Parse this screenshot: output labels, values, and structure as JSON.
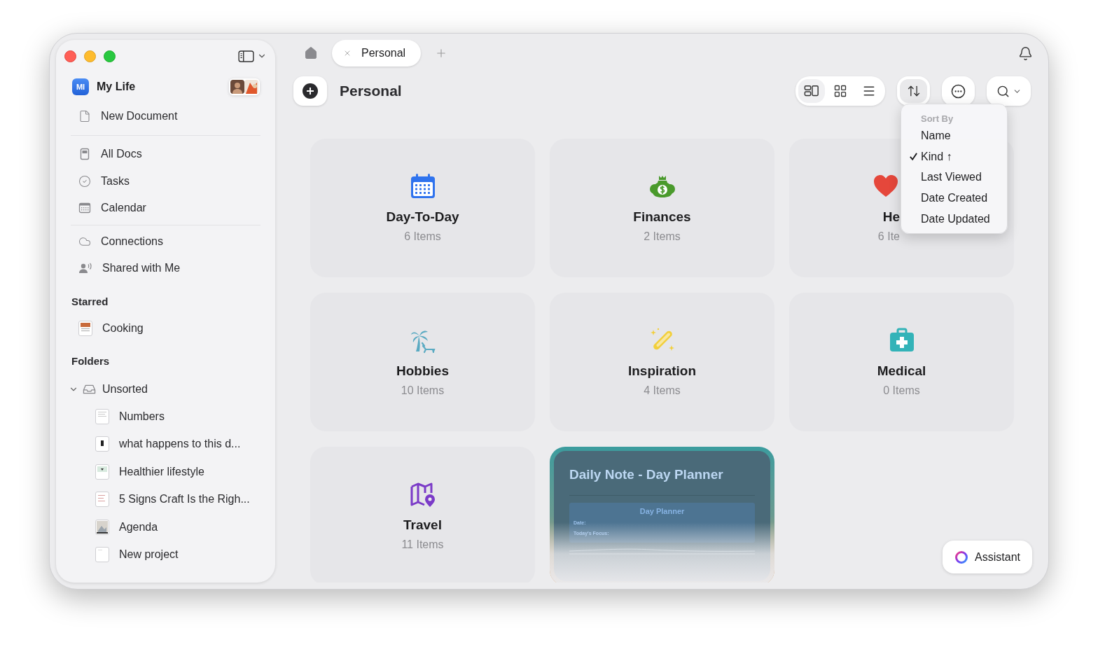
{
  "sidebar": {
    "workspace": {
      "badge": "MI",
      "name": "My Life"
    },
    "new_document": "New Document",
    "nav": [
      {
        "label": "All Docs"
      },
      {
        "label": "Tasks"
      },
      {
        "label": "Calendar"
      }
    ],
    "sources": [
      {
        "label": "Connections"
      },
      {
        "label": "Shared with Me"
      }
    ],
    "starred": {
      "title": "Starred",
      "items": [
        {
          "label": "Cooking"
        }
      ]
    },
    "folders": {
      "title": "Folders",
      "items": [
        {
          "label": "Unsorted",
          "expanded": true,
          "children": [
            {
              "label": "Numbers"
            },
            {
              "label": " what happens to this d..."
            },
            {
              "label": "Healthier lifestyle"
            },
            {
              "label": "5 Signs Craft Is the Righ..."
            },
            {
              "label": "Agenda"
            },
            {
              "label": "New project"
            }
          ]
        }
      ]
    }
  },
  "tabs": [
    {
      "label": "Personal",
      "selected": true
    }
  ],
  "page": {
    "title": "Personal"
  },
  "view_modes": [
    {
      "selected": true
    },
    {
      "selected": false
    },
    {
      "selected": false
    }
  ],
  "sort_menu": {
    "open": true,
    "title": "Sort By",
    "options": [
      {
        "label": "Name",
        "selected": false
      },
      {
        "label": "Kind ↑",
        "selected": true
      },
      {
        "label": "Last Viewed",
        "selected": false
      },
      {
        "label": "Date Created",
        "selected": false
      },
      {
        "label": "Date Updated",
        "selected": false
      }
    ]
  },
  "cards": [
    {
      "kind": "folder",
      "title": "Day-To-Day",
      "count": "6 Items"
    },
    {
      "kind": "folder",
      "title": "Finances",
      "count": "2 Items"
    },
    {
      "kind": "covered",
      "title": "He",
      "count": "6 Ite"
    },
    {
      "kind": "folder",
      "title": "Hobbies",
      "count": "10 Items"
    },
    {
      "kind": "folder",
      "title": "Inspiration",
      "count": "4 Items"
    },
    {
      "kind": "folder",
      "title": "Medical",
      "count": "0 Items"
    },
    {
      "kind": "folder",
      "title": "Travel",
      "count": "11 Items"
    },
    {
      "kind": "document",
      "title": "Daily Note - Day Planner",
      "heading": "Day Planner",
      "fields": [
        "Date:",
        "Today's Focus:"
      ]
    }
  ],
  "assistant": {
    "label": "Assistant"
  }
}
